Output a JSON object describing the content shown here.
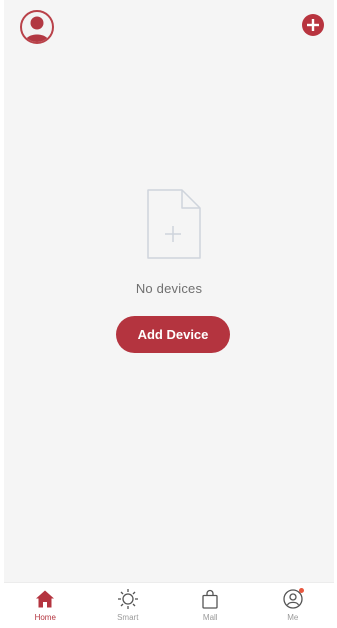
{
  "empty_state": {
    "message": "No devices",
    "action_label": "Add Device"
  },
  "tabs": [
    {
      "label": "Home",
      "icon": "home-icon",
      "active": true
    },
    {
      "label": "Smart",
      "icon": "sun-icon",
      "active": false
    },
    {
      "label": "Mall",
      "icon": "shopping-bag-icon",
      "active": false
    },
    {
      "label": "Me",
      "icon": "user-circle-icon",
      "active": false,
      "badge": true
    }
  ],
  "colors": {
    "accent": "#b4343f",
    "background": "#f5f5f5",
    "tab_inactive": "#9a9a9a",
    "badge": "#e8573f"
  }
}
